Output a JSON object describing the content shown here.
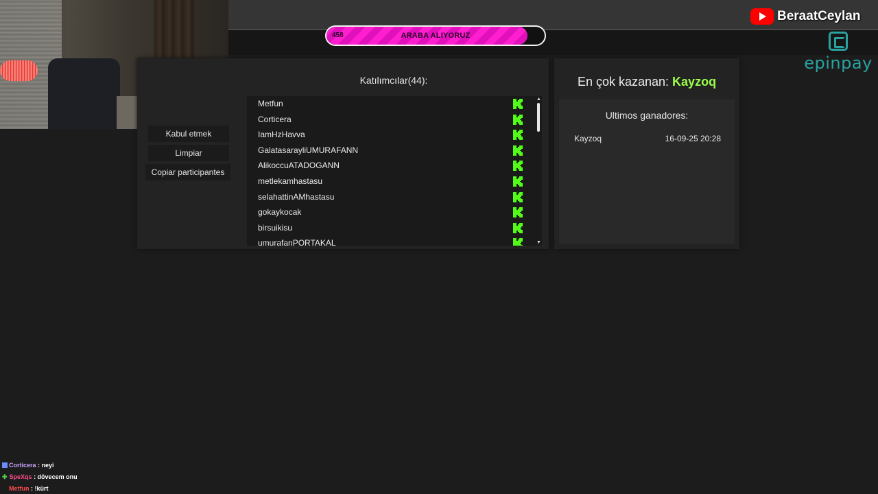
{
  "overlay": {
    "channel_name": "BeraatCeylan",
    "sponsor": "epinpay"
  },
  "goal": {
    "count": "458",
    "title": "ARABA ALIYORUZ",
    "progress_fraction": 0.92,
    "color": "#ff1fd0"
  },
  "actions": {
    "accept_label": "Kabul etmek",
    "clear_label": "Limpiar",
    "copy_label": "Copiar participantes"
  },
  "participants": {
    "title": "Katılımcılar(44):",
    "items": [
      "Metfun",
      "Corticera",
      "IamHzHavva",
      "GalatasarayliUMURAFANN",
      "AlikoccuATADOGANN",
      "metlekamhastasu",
      "selahattinAMhastasu",
      "gokaykocak",
      "birsuikisu",
      "umurafanPORTAKAL"
    ],
    "platform_icon": "kick-icon",
    "accent_color": "#53fc18"
  },
  "winners": {
    "top_label": "En çok kazanan:",
    "top_name": "Kayzoq",
    "top_color": "#9dff4a",
    "recent_title": "Ultimos ganadores:",
    "recent": [
      {
        "name": "Kayzoq",
        "date": "16-09-25 20:28"
      }
    ]
  },
  "chat": [
    {
      "user": "Corticera",
      "message": " : neyi",
      "color": "#c8a4ff"
    },
    {
      "user": "SpeXqs",
      "message": " : dövecem onu",
      "color": "#ff4d8d"
    },
    {
      "user": "Metfun",
      "message": " : !kürt",
      "color": "#ff4d4d"
    }
  ]
}
